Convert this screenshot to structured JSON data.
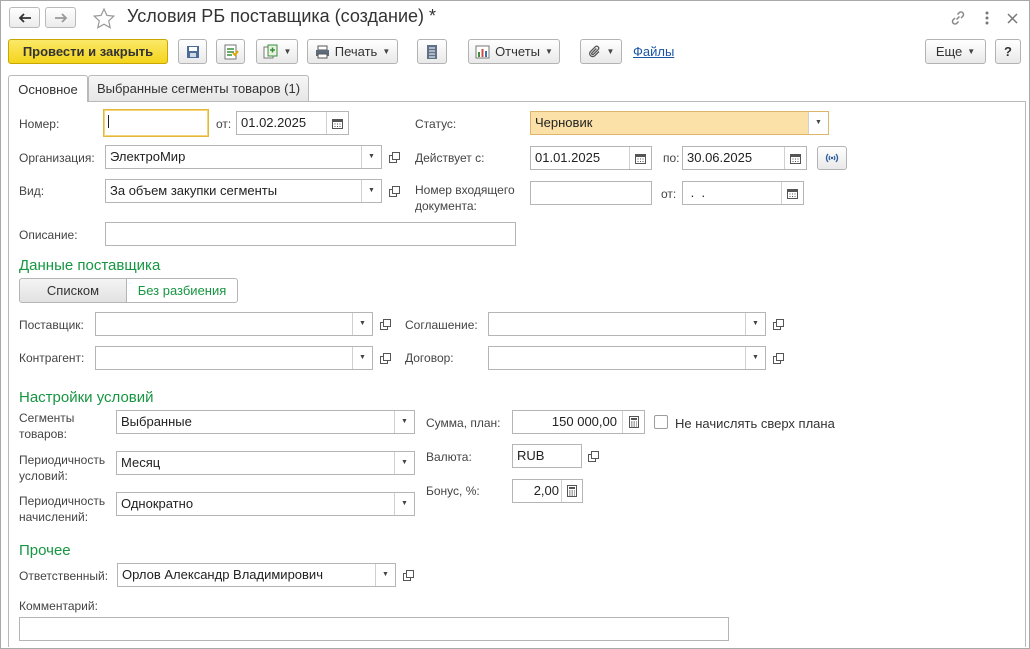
{
  "window": {
    "title": "Условия РБ поставщика (создание) *"
  },
  "icons": {
    "back": "arrow-left-icon",
    "forward": "arrow-right-icon",
    "favorite": "star-icon",
    "link": "link-icon",
    "menu": "more-vertical-icon",
    "close": "close-icon"
  },
  "toolbar": {
    "post_and_close": "Провести и закрыть",
    "print": "Печать",
    "reports": "Отчеты",
    "files": "Файлы",
    "more": "Еще",
    "help": "?"
  },
  "tabs": [
    {
      "label": "Основное",
      "active": true
    },
    {
      "label": "Выбранные сегменты товаров (1)",
      "active": false
    }
  ],
  "header": {
    "number_label": "Номер:",
    "number_value": "",
    "from_label": "от:",
    "from_value": "01.02.2025",
    "status_label": "Статус:",
    "status_value": "Черновик",
    "org_label": "Организация:",
    "org_value": "ЭлектроМир",
    "valid_label": "Действует с:",
    "valid_from": "01.01.2025",
    "to_label": "по:",
    "valid_to": "30.06.2025",
    "kind_label": "Вид:",
    "kind_value": "За объем закупки сегменты",
    "incoming_label_1": "Номер входящего",
    "incoming_label_2": "документа:",
    "incoming_value": "",
    "incoming_from_label": "от:",
    "incoming_from_value": " .  .",
    "desc_label": "Описание:",
    "desc_value": ""
  },
  "supplier": {
    "section_title": "Данные поставщика",
    "mode_list": "Списком",
    "mode_nosplit": "Без разбиения",
    "supplier_label": "Поставщик:",
    "agreement_label": "Соглашение:",
    "counterparty_label": "Контрагент:",
    "contract_label": "Договор:"
  },
  "conditions": {
    "section_title": "Настройки условий",
    "segments_label_1": "Сегменты",
    "segments_label_2": "товаров:",
    "segments_value": "Выбранные",
    "amount_label": "Сумма, план:",
    "amount_value": "150 000,00",
    "no_over_plan_label": "Не начислять сверх плана",
    "no_over_plan_checked": false,
    "periodicity_label_1": "Периодичность",
    "periodicity_label_2": "условий:",
    "periodicity_value": "Месяц",
    "currency_label": "Валюта:",
    "currency_value": "RUB",
    "accrual_label_1": "Периодичность",
    "accrual_label_2": "начислений:",
    "accrual_value": "Однократно",
    "bonus_label": "Бонус, %:",
    "bonus_value": "2,00"
  },
  "other": {
    "section_title": "Прочее",
    "responsible_label": "Ответственный:",
    "responsible_value": "Орлов Александр Владимирович",
    "comment_label": "Комментарий:",
    "comment_value": ""
  },
  "colors": {
    "accent_green": "#179642",
    "primary_yellow": "#f3d41b",
    "status_fill": "#fbe1a8",
    "link_blue": "#1a55a8"
  }
}
